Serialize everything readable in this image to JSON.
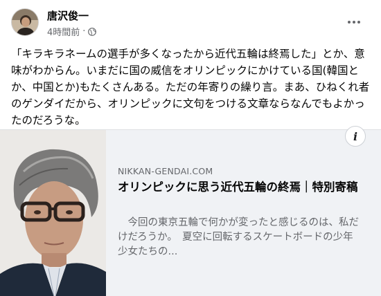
{
  "post": {
    "author": "唐沢俊一",
    "time": "4時間前",
    "separator": "·",
    "privacy_icon": "globe-icon",
    "more_icon": "more-options-icon",
    "text": "「キラキラネームの選手が多くなったから近代五輪は終焉した」とか、意味がわからん。いまだに国の威信をオリンピックにかけている国(韓国とか、中国とか)もたくさんある。ただの年寄りの繰り言。まあ、ひねくれ者のゲンダイだから、オリンピックに文句をつける文章ならなんでもよかったのだろうな。"
  },
  "link_preview": {
    "info_icon": "info-icon",
    "info_label": "i",
    "domain": "NIKKAN-GENDAI.COM",
    "headline": "オリンピックに思う近代五輪の終焉｜特別寄稿",
    "description": "　今回の東京五輪で何かが変ったと感じるのは、私だけだろうか。　夏空に回転するスケートボードの少年少女たちの..."
  },
  "colors": {
    "text_primary": "#050505",
    "text_secondary": "#65676b",
    "preview_bg": "#f0f2f5"
  }
}
